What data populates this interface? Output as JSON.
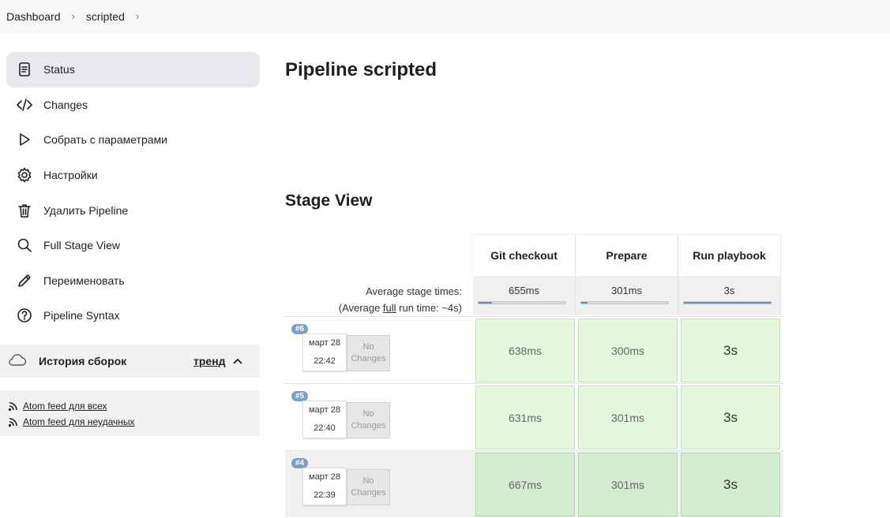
{
  "breadcrumb": [
    "Dashboard",
    "scripted"
  ],
  "sidebar": {
    "items": [
      {
        "label": "Status",
        "icon": "document-icon",
        "active": true
      },
      {
        "label": "Changes",
        "icon": "code-icon"
      },
      {
        "label": "Собрать с параметрами",
        "icon": "play-icon"
      },
      {
        "label": "Настройки",
        "icon": "gear-icon"
      },
      {
        "label": "Удалить Pipeline",
        "icon": "trash-icon"
      },
      {
        "label": "Full Stage View",
        "icon": "search-icon"
      },
      {
        "label": "Переименовать",
        "icon": "pencil-icon"
      },
      {
        "label": "Pipeline Syntax",
        "icon": "help-icon"
      }
    ]
  },
  "history": {
    "title": "История сборок",
    "trend": "тренд"
  },
  "feeds": {
    "all": "Atom feed для всех",
    "failed": "Atom feed для неудачных"
  },
  "main": {
    "title": "Pipeline scripted",
    "stage_view_title": "Stage View"
  },
  "stage_view": {
    "stages": [
      "Git checkout",
      "Prepare",
      "Run playbook"
    ],
    "avg_label_1": "Average stage times:",
    "avg_label_2_pre": "(Average ",
    "avg_label_2_link": "full",
    "avg_label_2_post": " run time: ~4s)",
    "avg_times": [
      "655ms",
      "301ms",
      "3s"
    ],
    "avg_fill": [
      0.15,
      0.07,
      1.0
    ],
    "runs": [
      {
        "id": "#6",
        "date": "март 28",
        "time": "22:42",
        "changes": "No Changes",
        "times": [
          "638ms",
          "300ms",
          "3s"
        ]
      },
      {
        "id": "#5",
        "date": "март 28",
        "time": "22:40",
        "changes": "No Changes",
        "times": [
          "631ms",
          "301ms",
          "3s"
        ]
      },
      {
        "id": "#4",
        "date": "март 28",
        "time": "22:39",
        "changes": "No Changes",
        "times": [
          "667ms",
          "301ms",
          "3s"
        ]
      }
    ]
  }
}
